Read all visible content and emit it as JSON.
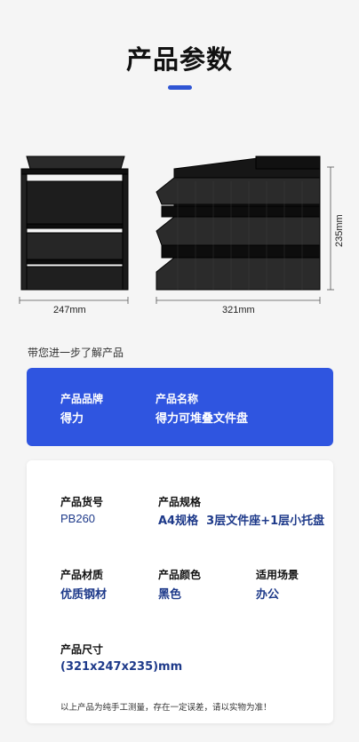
{
  "header": {
    "title": "产品参数"
  },
  "dimensions": {
    "width_a": "247mm",
    "width_b": "321mm",
    "height": "235mm"
  },
  "subhead": "带您进一步了解产品",
  "brand_card": {
    "brand_label": "产品品牌",
    "brand_value": "得力",
    "name_label": "产品名称",
    "name_value": "得力可堆叠文件盘"
  },
  "spec_card": {
    "sku_label": "产品货号",
    "sku_value": "PB260",
    "spec_label": "产品规格",
    "spec_value": "A4规格  3层文件座+1层小托盘",
    "material_label": "产品材质",
    "material_value": "优质钢材",
    "color_label": "产品颜色",
    "color_value": "黑色",
    "scene_label": "适用场景",
    "scene_value": "办公",
    "size_label": "产品尺寸",
    "size_value": "(321x247x235)mm",
    "note": "以上产品为纯手工测量，存在一定误差，请以实物为准！"
  },
  "colors": {
    "accent": "#2f55e0",
    "value_text": "#1e3a8a"
  }
}
